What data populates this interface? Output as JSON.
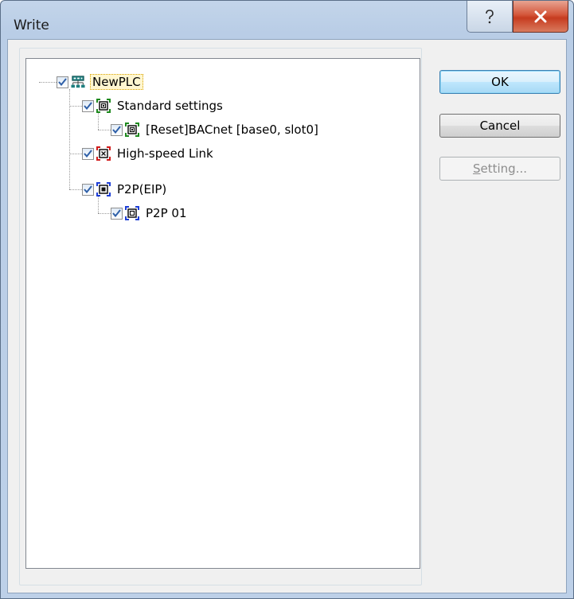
{
  "window": {
    "title": "Write",
    "help_glyph": "?",
    "close_glyph": "✕"
  },
  "tree": {
    "root": {
      "label": "NewPLC",
      "checked": true,
      "icon": "plc-network-icon"
    },
    "standard": {
      "label": "Standard settings",
      "checked": true,
      "icon": "standard-settings-icon",
      "color": "#1e8a1e"
    },
    "bacnet": {
      "label": "[Reset]BACnet [base0, slot0]",
      "checked": true,
      "icon": "module-icon",
      "color": "#1e8a1e"
    },
    "hslink": {
      "label": "High-speed Link",
      "checked": true,
      "icon": "highspeed-link-icon",
      "color": "#d11b1b"
    },
    "p2p": {
      "label": "P2P(EIP)",
      "checked": true,
      "icon": "p2p-icon",
      "color": "#1d3ed6"
    },
    "p2p01": {
      "label": "P2P 01",
      "checked": true,
      "icon": "p2p-block-icon",
      "color": "#1d3ed6"
    }
  },
  "buttons": {
    "ok": "OK",
    "cancel": "Cancel",
    "setting_mnemonic": "S",
    "setting_rest": "etting..."
  }
}
